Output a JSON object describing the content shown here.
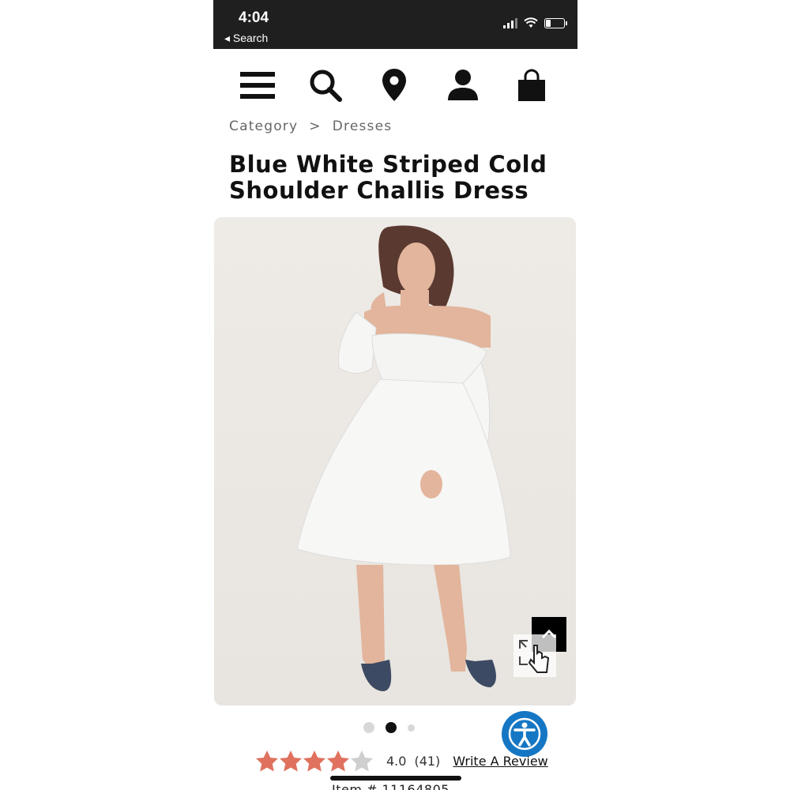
{
  "status_bar": {
    "time": "4:04",
    "back_label": "◂ Search",
    "icons": [
      "signal-icon",
      "wifi-icon",
      "battery-icon"
    ]
  },
  "nav": {
    "icons": [
      "menu-icon",
      "search-icon",
      "location-pin-icon",
      "account-icon",
      "shopping-bag-icon"
    ]
  },
  "breadcrumb": {
    "items": [
      "Category",
      "Dresses"
    ],
    "separator": ">"
  },
  "product": {
    "title": "Blue White Striped Cold Shoulder Challis Dress",
    "rating_value": "4.0",
    "rating_count": "(41)",
    "stars_filled": 4,
    "stars_total": 5,
    "write_review_label": "Write A Review",
    "item_number": "Item # 11164805"
  },
  "carousel": {
    "dots": 3,
    "active_index": 1
  },
  "colors": {
    "status_bar_bg": "#1f1f1f",
    "star_filled": "#e0715f",
    "star_empty": "#cfcfcf",
    "accessibility_blue": "#1577c4",
    "image_bg": "#ede9e4"
  }
}
